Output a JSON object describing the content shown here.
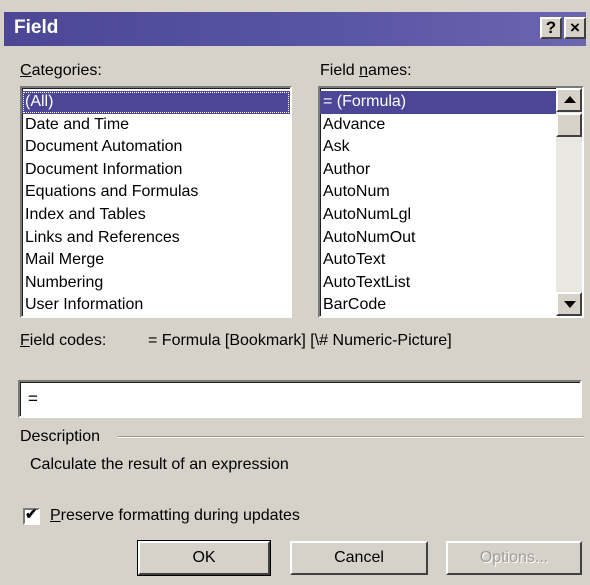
{
  "window": {
    "title": "Field",
    "help_button": "?",
    "close_button": "×"
  },
  "categories": {
    "label_access_key": "C",
    "label_rest": "ategories:",
    "items": [
      {
        "label": "(All)",
        "selected": true
      },
      {
        "label": "Date and Time"
      },
      {
        "label": "Document Automation"
      },
      {
        "label": "Document Information"
      },
      {
        "label": "Equations and Formulas"
      },
      {
        "label": "Index and Tables"
      },
      {
        "label": "Links and References"
      },
      {
        "label": "Mail Merge"
      },
      {
        "label": "Numbering"
      },
      {
        "label": "User Information"
      }
    ]
  },
  "field_names": {
    "label_before": "Field ",
    "label_access_key": "n",
    "label_after": "ames:",
    "items": [
      {
        "label": "= (Formula)",
        "selected": true
      },
      {
        "label": "Advance"
      },
      {
        "label": "Ask"
      },
      {
        "label": "Author"
      },
      {
        "label": "AutoNum"
      },
      {
        "label": "AutoNumLgl"
      },
      {
        "label": "AutoNumOut"
      },
      {
        "label": "AutoText"
      },
      {
        "label": "AutoTextList"
      },
      {
        "label": "BarCode"
      }
    ]
  },
  "field_codes": {
    "label_access_key": "F",
    "label_rest": "ield codes:",
    "syntax": "= Formula [Bookmark] [\\# Numeric-Picture]",
    "value": "="
  },
  "description": {
    "label": "Description",
    "text": "Calculate the result of an expression"
  },
  "preserve_formatting": {
    "checked": true,
    "check_glyph": "✔",
    "label_access_key": "P",
    "label_rest": "reserve formatting during updates"
  },
  "buttons": {
    "ok": "OK",
    "cancel": "Cancel",
    "options": "Options..."
  },
  "colors": {
    "titlebar": "#4b4796",
    "selection": "#4b4796",
    "face": "#d6d2c9"
  }
}
